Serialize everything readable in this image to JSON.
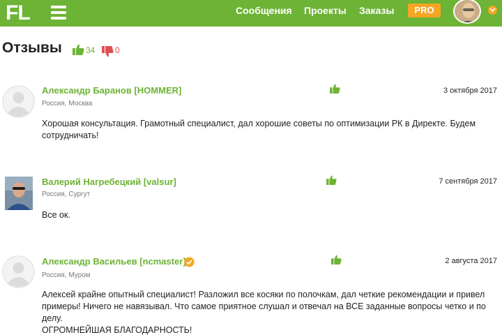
{
  "header": {
    "logo": "FL",
    "nav": {
      "messages": "Сообщения",
      "projects": "Проекты",
      "orders": "Заказы"
    },
    "pro_label": "PRO"
  },
  "reviews_section": {
    "title": "Отзывы",
    "positive_count": "34",
    "negative_count": "0"
  },
  "reviews": [
    {
      "author": "Александр Баранов [HOMMER]",
      "location": "Россия, Москва",
      "date": "3 октября 2017",
      "text": "Хорошая консультация. Грамотный специалист, дал хорошие советы по оптимизации РК в Директе. Будем сотрудничать!"
    },
    {
      "author": "Валерий Нагребецкий [valsur]",
      "location": "Россия, Сургут",
      "date": "7 сентября 2017",
      "text": "Все ок."
    },
    {
      "author": "Александр Васильев [ncmaster]",
      "location": "Россия, Муром",
      "date": "2 августа 2017",
      "text_lines": [
        "Алексей крайне опытный специалист! Разложил все косяки по полочкам, дал четкие рекомендации и привел",
        "примеры! Ничего не навязывал. Что самое приятное слушал и отвечал на ВСЕ заданные вопросы четко и по",
        "делу.",
        "ОГРОМНЕЙШАЯ БЛАГОДАРНОСТЬ!"
      ]
    }
  ],
  "colors": {
    "brand_green": "#6db335",
    "pro_orange": "#f5a623",
    "negative_red": "#e05050"
  }
}
